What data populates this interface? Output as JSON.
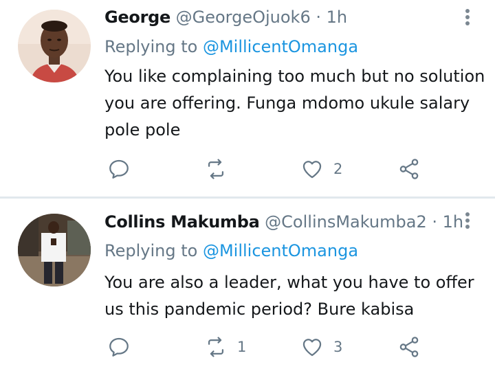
{
  "tweets": [
    {
      "name": "George",
      "handle": "@GeorgeOjuok6",
      "separator": "·",
      "time": "1h",
      "replying_prefix": "Replying to",
      "replying_to": "@MillicentOmanga",
      "text": "You like complaining too much but no solution you are offering. Funga mdomo ukule salary pole pole",
      "retweets": "",
      "likes": "2",
      "avatar_icon": "user-avatar-photo"
    },
    {
      "name": "Collins Makumba",
      "handle": "@CollinsMakumba2",
      "separator": "·",
      "time": "1h",
      "replying_prefix": "Replying to",
      "replying_to": "@MillicentOmanga",
      "text": "You are also a leader, what you have to offer us this pandemic period? Bure kabisa",
      "retweets": "1",
      "likes": "3",
      "avatar_icon": "user-avatar-photo"
    }
  ],
  "colors": {
    "name": "#14171a",
    "secondary": "#657786",
    "link": "#1b95e0",
    "divider": "#e1e8ed",
    "icon": "#657786"
  }
}
